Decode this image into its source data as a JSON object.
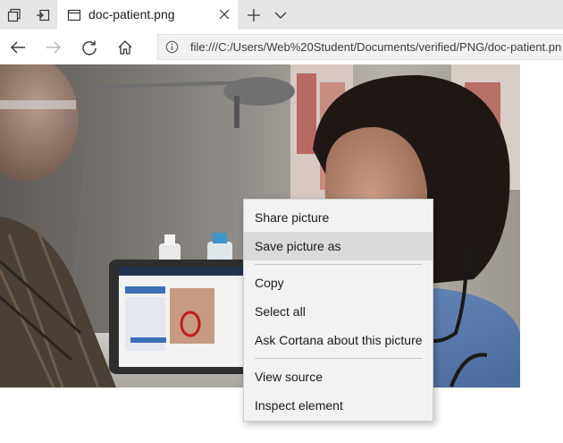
{
  "tab": {
    "title": "doc-patient.png"
  },
  "address_bar": {
    "url": "file:///C:/Users/Web%20Student/Documents/verified/PNG/doc-patient.pn"
  },
  "icons": {
    "tab_preview": "tabs-aside-icon",
    "set_aside": "set-tabs-aside-icon",
    "favicon": "page-icon",
    "close": "close-icon",
    "new_tab": "plus-icon",
    "tab_list": "chevron-down-icon",
    "back": "back-arrow-icon",
    "forward": "forward-arrow-icon",
    "refresh": "refresh-icon",
    "home": "home-icon",
    "site_info": "info-icon"
  },
  "context_menu": {
    "items": [
      {
        "label": "Share picture"
      },
      {
        "label": "Save picture as"
      },
      {
        "label": "Copy"
      },
      {
        "label": "Select all"
      },
      {
        "label": "Ask Cortana about this picture"
      },
      {
        "label": "View source"
      },
      {
        "label": "Inspect element"
      }
    ],
    "hovered_item": "Save picture as"
  },
  "colors": {
    "tabstrip_bg": "#e6e6e6",
    "menu_bg": "#f2f2f2",
    "menu_hover": "#dadada",
    "scrubs_blue": "#5b7fb3"
  }
}
